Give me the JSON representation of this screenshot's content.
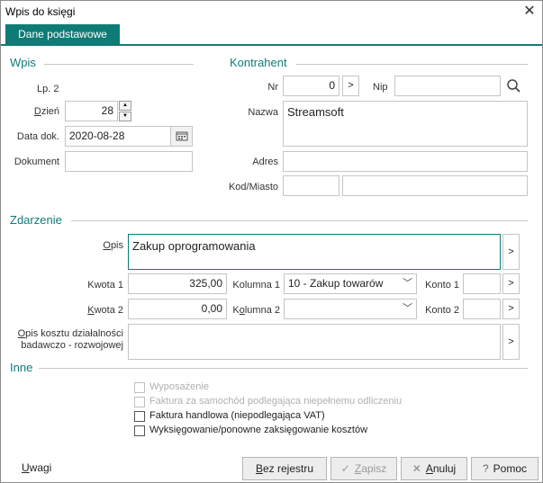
{
  "window": {
    "title": "Wpis do księgi"
  },
  "tabs": [
    {
      "label": "Dane podstawowe"
    }
  ],
  "wpis": {
    "section": "Wpis",
    "lp_label": "Lp.",
    "lp_value": "2",
    "dzien_label_u": "D",
    "dzien_label_rest": "zień",
    "dzien_value": "28",
    "data_label": "Data dok.",
    "data_value": "2020-08-28",
    "dokument_label": "Dokument",
    "dokument_value": ""
  },
  "kontrahent": {
    "section": "Kontrahent",
    "nr_label": "Nr",
    "nr_value": "0",
    "nr_button": ">",
    "nip_label": "Nip",
    "nip_value": "",
    "nazwa_label": "Nazwa",
    "nazwa_value": "Streamsoft",
    "adres_label": "Adres",
    "adres_value": "",
    "kod_label": "Kod/Miasto",
    "kod_value": "",
    "miasto_value": ""
  },
  "zdarzenie": {
    "section": "Zdarzenie",
    "opis_label_u": "O",
    "opis_label_rest": "pis",
    "opis_value": "Zakup oprogramowania",
    "kwota1_label": "Kwota 1",
    "kwota1_value": "325,00",
    "kolumna1_label": "Kolumna 1",
    "kolumna1_value": "10 - Zakup towarów",
    "konto1_label": "Konto 1",
    "konto1_value": "",
    "kwota2_label_u": "K",
    "kwota2_label_rest": "wota 2",
    "kwota2_value": "0,00",
    "kolumna2_label_pre": "K",
    "kolumna2_label_u": "o",
    "kolumna2_label_rest": "lumna 2",
    "kolumna2_value": "",
    "konto2_label": "Konto 2",
    "konto2_value": "",
    "opis_kosztu_label_u": "O",
    "opis_kosztu_label_rest": "pis kosztu działalności",
    "opis_kosztu_label2": "badawczo - rozwojowej",
    "opis_kosztu_value": "",
    "arrow": ">"
  },
  "inne": {
    "section": "Inne",
    "checkboxes": [
      {
        "label": "Wyposażenie",
        "disabled": true
      },
      {
        "label": "Faktura za samochód podlegająca niepełnemu odliczeniu",
        "disabled": true
      },
      {
        "label": "Faktura handlowa (niepodlegająca VAT)",
        "disabled": false
      },
      {
        "label": "Wyksięgowanie/ponowne zaksięgowanie kosztów",
        "disabled": false
      }
    ]
  },
  "footer": {
    "uwagi_u": "U",
    "uwagi_rest": "wagi",
    "bez_rejestru_u": "B",
    "bez_rejestru_rest": "ez rejestru",
    "zapisz_u": "Z",
    "zapisz_rest": "apisz",
    "anuluj_u": "A",
    "anuluj_rest": "nuluj",
    "pomoc": "Pomoc"
  },
  "colors": {
    "accent": "#0f7b76",
    "border": "#c5c5c5"
  }
}
